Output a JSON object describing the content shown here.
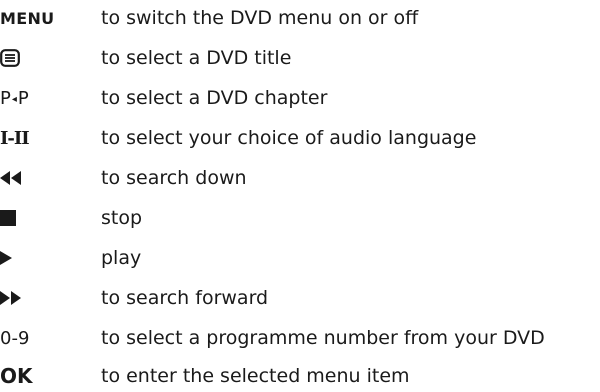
{
  "rows": [
    {
      "key": "MENU",
      "desc": "to switch the DVD menu on or off"
    },
    {
      "key_icon": "teletext-menu-icon",
      "desc": "to select a DVD title"
    },
    {
      "key_left": "P",
      "key_mid": "◂",
      "key_right": "P",
      "desc": "to select a DVD chapter"
    },
    {
      "key": "I-II",
      "desc": "to select your choice of audio language"
    },
    {
      "key_icon": "rewind-icon",
      "desc": "to search down"
    },
    {
      "key_icon": "stop-icon",
      "desc": "stop"
    },
    {
      "key_icon": "play-icon",
      "desc": "play"
    },
    {
      "key_icon": "fast-forward-icon",
      "desc": "to search forward"
    },
    {
      "key": "0-9",
      "desc": "to select a programme number from your DVD"
    },
    {
      "key": "OK",
      "desc": "to enter the selected menu item"
    }
  ]
}
